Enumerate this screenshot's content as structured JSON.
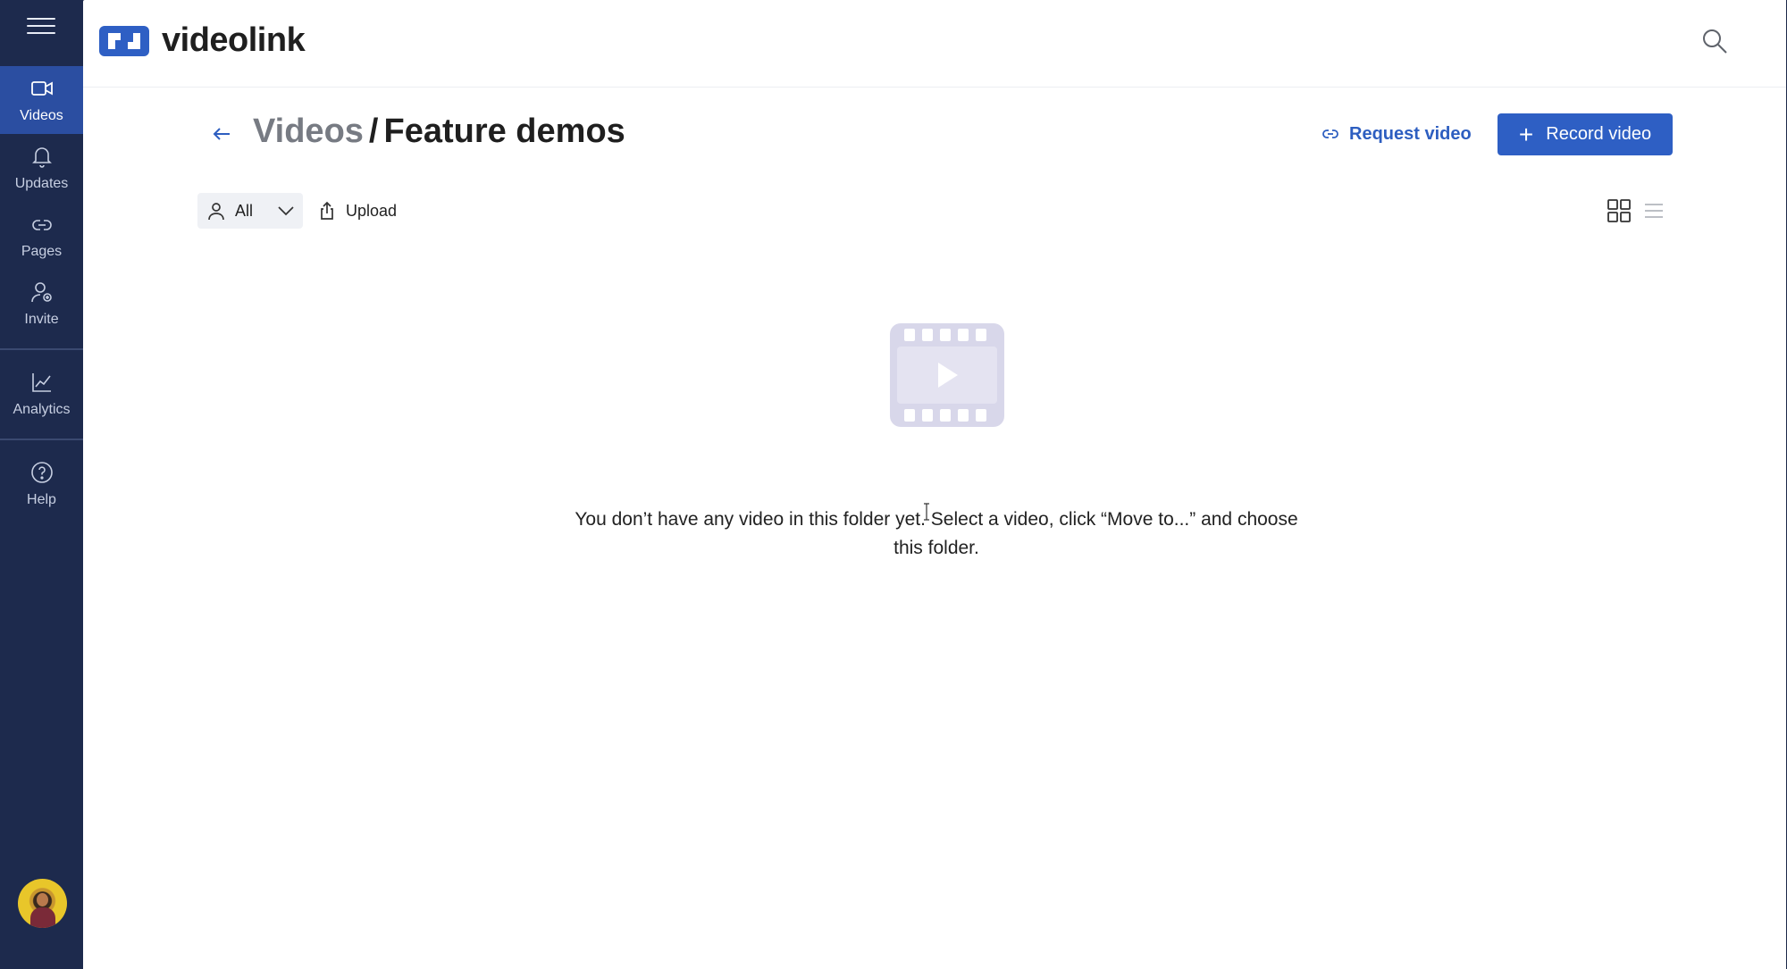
{
  "app": {
    "name": "videolink",
    "brand_color": "#2e5fc4",
    "sidebar_color": "#1d2a4d"
  },
  "sidebar": {
    "items": [
      {
        "label": "Videos",
        "icon": "video-icon",
        "active": true
      },
      {
        "label": "Updates",
        "icon": "bell-icon",
        "active": false
      },
      {
        "label": "Pages",
        "icon": "link-pages-icon",
        "active": false
      },
      {
        "label": "Invite",
        "icon": "invite-user-icon",
        "active": false
      },
      {
        "label": "Analytics",
        "icon": "analytics-chart-icon",
        "active": false
      },
      {
        "label": "Help",
        "icon": "help-icon",
        "active": false
      }
    ]
  },
  "header": {
    "breadcrumb_parent": "Videos",
    "breadcrumb_separator": "/",
    "breadcrumb_current": "Feature demos",
    "request_label": "Request video",
    "record_label": "Record video"
  },
  "toolbar": {
    "filter_value": "All",
    "upload_label": "Upload"
  },
  "empty_state": {
    "message": "You don’t have any video in this folder yet. Select a video, click “Move to...” and choose this folder."
  }
}
